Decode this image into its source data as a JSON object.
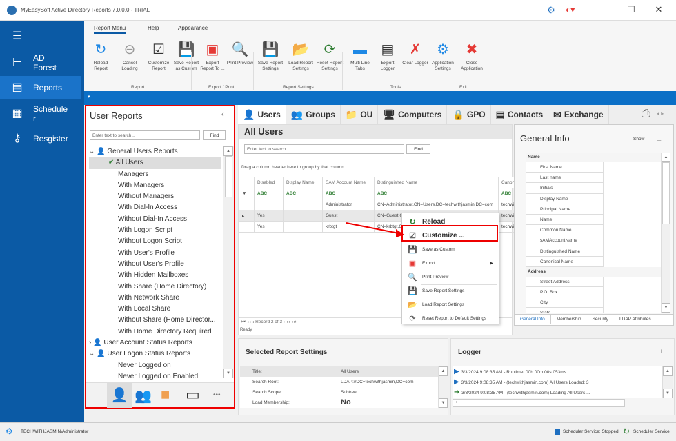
{
  "window": {
    "title": "MyEasySoft Active Directory Reports 7.0.0.0 - TRIAL",
    "minimize": "—",
    "maximize": "☐",
    "close": "✕"
  },
  "sidebar": {
    "items": [
      {
        "label": "AD Forest",
        "icon": "tree-icon"
      },
      {
        "label": "Reports",
        "icon": "report-icon"
      },
      {
        "label": "Schedule r",
        "icon": "schedule-icon"
      },
      {
        "label": "Resgister",
        "icon": "key-icon"
      }
    ]
  },
  "ribbon": {
    "tabs": [
      "Report Menu",
      "Help",
      "Appearance"
    ],
    "buttons": [
      {
        "label": "Reload Report",
        "icon": "reload-icon",
        "color": "#1e88e5"
      },
      {
        "label": "Cancel Loading",
        "icon": "cancel-icon",
        "color": "#999999"
      },
      {
        "label": "Customize Report",
        "icon": "customize-icon",
        "color": "#333333"
      },
      {
        "label": "Save Report as Custom",
        "icon": "save-custom-icon",
        "color": "#333333"
      },
      {
        "label": "Export Report To ...",
        "icon": "pdf-icon",
        "color": "#e53935"
      },
      {
        "label": "Print Preview",
        "icon": "print-preview-icon",
        "color": "#333333"
      },
      {
        "label": "Save Report Settings",
        "icon": "save-settings-icon",
        "color": "#333333"
      },
      {
        "label": "Load Report Settings",
        "icon": "load-settings-icon",
        "color": "#f0a050"
      },
      {
        "label": "Reset Report Settings",
        "icon": "reset-settings-icon",
        "color": "#2e7d32"
      },
      {
        "label": "Multi Line Tabs",
        "icon": "multiline-tabs-icon",
        "color": "#1e88e5"
      },
      {
        "label": "Export Logger",
        "icon": "log-icon",
        "color": "#333333"
      },
      {
        "label": "Clear Logger",
        "icon": "clear-logger-icon",
        "color": "#e53935"
      },
      {
        "label": "Application Settings",
        "icon": "gear-icon",
        "color": "#1e88e5"
      },
      {
        "label": "Close Application",
        "icon": "close-app-icon",
        "color": "#e53935"
      }
    ],
    "groups": [
      "Report",
      "Export / Print",
      "Report Settings",
      "Tools",
      "Exit"
    ]
  },
  "left_panel": {
    "title": "User Reports",
    "search_placeholder": "Enter text to search...",
    "find": "Find",
    "tree": [
      {
        "label": "General Users Reports",
        "level": 1,
        "expanded": true
      },
      {
        "label": "All Users",
        "level": 2,
        "selected": true
      },
      {
        "label": "Managers",
        "level": 2
      },
      {
        "label": "With Managers",
        "level": 2
      },
      {
        "label": "Without Managers",
        "level": 2
      },
      {
        "label": "With Dial-In Access",
        "level": 2
      },
      {
        "label": "Without Dial-In Access",
        "level": 2
      },
      {
        "label": "With Logon Script",
        "level": 2
      },
      {
        "label": "Without Logon Script",
        "level": 2
      },
      {
        "label": "With User's Profile",
        "level": 2
      },
      {
        "label": "Without User's Profile",
        "level": 2
      },
      {
        "label": "With Hidden Mailboxes",
        "level": 2
      },
      {
        "label": "With Share (Home Directory)",
        "level": 2
      },
      {
        "label": "With Network Share",
        "level": 2
      },
      {
        "label": "With Local Share",
        "level": 2
      },
      {
        "label": "Without Share (Home Director...",
        "level": 2
      },
      {
        "label": "With Home Directory Required",
        "level": 2
      },
      {
        "label": "User Account Status Reports",
        "level": 1,
        "expanded": false
      },
      {
        "label": "User Logon Status Reports",
        "level": 1,
        "expanded": true
      },
      {
        "label": "Never Logged on",
        "level": 2
      },
      {
        "label": "Never Logged on Enabled",
        "level": 2
      }
    ],
    "more": "•••"
  },
  "object_tabs": [
    {
      "label": "Users",
      "icon": "user-icon"
    },
    {
      "label": "Groups",
      "icon": "group-icon"
    },
    {
      "label": "OU",
      "icon": "folder-icon"
    },
    {
      "label": "Computers",
      "icon": "computer-icon"
    },
    {
      "label": "GPO",
      "icon": "gpo-icon"
    },
    {
      "label": "Contacts",
      "icon": "contact-icon"
    },
    {
      "label": "Exchange",
      "icon": "mail-icon"
    }
  ],
  "grid": {
    "title": "All Users",
    "search_placeholder": "Enter text to search...",
    "find": "Find",
    "group_hint": "Drag a column header here to group by that column",
    "columns": [
      "Disabled",
      "Display Name",
      "SAM Account Name",
      "Distinguished Name",
      "Canonical N"
    ],
    "filter": "ABC",
    "rows": [
      [
        "",
        "",
        "Administrator",
        "CN=Administrator,CN=Users,DC=techwithjasmin,DC=com",
        "techwithjas"
      ],
      [
        "Yes",
        "",
        "Guest",
        "CN=Guest,CN",
        "techwithjas"
      ],
      [
        "Yes",
        "",
        "krbtgt",
        "CN=krbtgt,CN",
        "techwithjas"
      ]
    ],
    "nav": "Record 2 of 3",
    "status": "Ready"
  },
  "context_menu": {
    "items": [
      {
        "label": "Reload",
        "icon": "reload-icon"
      },
      {
        "label": "Customize ...",
        "icon": "customize-icon",
        "highlighted": true
      },
      {
        "label": "Save as Custom",
        "icon": "save-custom-icon"
      },
      {
        "label": "Export",
        "icon": "pdf-icon",
        "submenu": true
      },
      {
        "label": "Print Preview",
        "icon": "print-preview-icon"
      },
      {
        "label": "Save Report Settings",
        "icon": "save-settings-icon"
      },
      {
        "label": "Load Report Settings",
        "icon": "load-settings-icon"
      },
      {
        "label": "Reset Report to Default Settings",
        "icon": "reset-settings-icon"
      }
    ]
  },
  "general_info": {
    "title": "General Info",
    "show": "Show",
    "sections": [
      {
        "name": "Name",
        "fields": [
          "First Name",
          "Last name",
          "Initials",
          "Display Name",
          "Principal Name",
          "Name",
          "Common Name",
          "sAMAccountName",
          "Distinguished Name",
          "Canonical Name"
        ]
      },
      {
        "name": "Address",
        "fields": [
          "Street Address",
          "P.O. Box",
          "City",
          "State"
        ]
      }
    ],
    "tabs": [
      "General Info",
      "Membership",
      "Security",
      "LDAP Attributes"
    ]
  },
  "settings": {
    "title": "Selected Report Settings",
    "rows": [
      [
        "Title:",
        "All Users"
      ],
      [
        "Search Root:",
        "LDAP://DC=techwithjasmin,DC=com"
      ],
      [
        "Search Scope:",
        "Subtree"
      ],
      [
        "Load Membership:",
        "No"
      ]
    ]
  },
  "logger": {
    "title": "Logger",
    "entries": [
      {
        "text": "3/3/2024 9:08:35 AM - Runtime: 00h 00m 00s 053ms",
        "icon": "flag-icon"
      },
      {
        "text": "3/3/2024 9:08:35 AM - (techwithjasmin.com) All Users Loaded: 3",
        "icon": "flag-icon"
      },
      {
        "text": "3/3/2024 9:08:35 AM - (techwithjasmin.com) Loading All Users ...",
        "icon": "arrow-right-icon"
      }
    ]
  },
  "statusbar": {
    "user": "TECHWITHJASMIN\\Administrator",
    "service_status": "Scheduler Service: Stopped",
    "service": "Scheduler Service"
  },
  "colors": {
    "accent": "#0b5aa5",
    "highlight": "#e00000"
  }
}
